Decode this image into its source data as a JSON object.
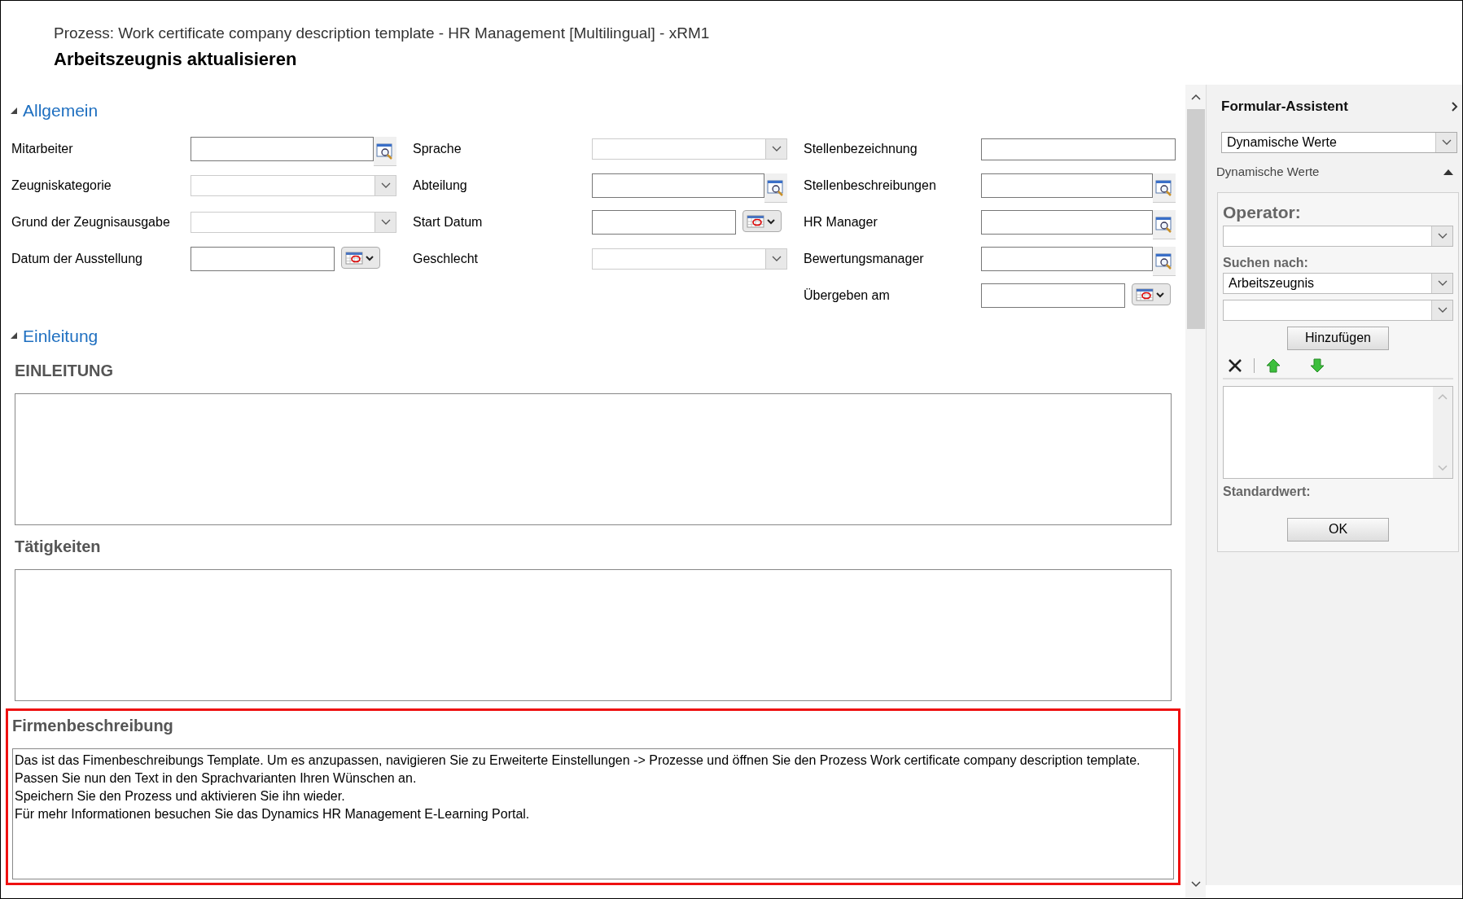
{
  "process_title": "Prozess: Work certificate company description template - HR Management [Multilingual] - xRM1",
  "form_title": "Arbeitszeugnis aktualisieren",
  "general": {
    "title": "Allgemein",
    "expanded": true,
    "columns": [
      [
        {
          "label": "Mitarbeiter",
          "kind": "lookup"
        },
        {
          "label": "Zeugniskategorie",
          "kind": "select"
        },
        {
          "label": "Grund der Zeugnisausgabe",
          "kind": "select"
        },
        {
          "label": "Datum der Ausstellung",
          "kind": "date"
        }
      ],
      [
        {
          "label": "Sprache",
          "kind": "select"
        },
        {
          "label": "Abteilung",
          "kind": "lookup"
        },
        {
          "label": "Start Datum",
          "kind": "date"
        },
        {
          "label": "Geschlecht",
          "kind": "select"
        }
      ],
      [
        {
          "label": "Stellenbezeichnung",
          "kind": "text"
        },
        {
          "label": "Stellenbeschreibungen",
          "kind": "lookup"
        },
        {
          "label": "HR Manager",
          "kind": "lookup"
        },
        {
          "label": "Bewertungsmanager",
          "kind": "lookup"
        },
        {
          "label": "Übergeben am",
          "kind": "date"
        }
      ]
    ]
  },
  "intro": {
    "title": "Einleitung",
    "expanded": true,
    "text_fields": [
      {
        "label": "EINLEITUNG",
        "highlighted": false
      },
      {
        "label": "Tätigkeiten",
        "highlighted": false
      },
      {
        "label": "Firmenbeschreibung",
        "highlighted": true,
        "lines": [
          "Das ist das Fimenbeschreibungs Template. Um es anzupassen, navigieren Sie zu Erweiterte Einstellungen -> Prozesse und öffnen Sie den Prozess Work certificate company description template.",
          "Passen Sie nun den Text in den Sprachvarianten Ihren Wünschen an.",
          "Speichern Sie den Prozess und aktivieren Sie ihn wieder.",
          "Für mehr Informationen besuchen Sie das Dynamics HR Management E-Learning Portal."
        ]
      }
    ]
  },
  "assistant": {
    "title": "Formular-Assistent",
    "mode": "Dynamische Werte",
    "section": {
      "title": "Dynamische Werte",
      "expanded": true
    },
    "operator_label": "Operator:",
    "search_label": "Suchen nach:",
    "search_value": "Arbeitszeugnis",
    "add_button": "Hinzufügen",
    "default_label": "Standardwert:",
    "ok_button": "OK"
  }
}
